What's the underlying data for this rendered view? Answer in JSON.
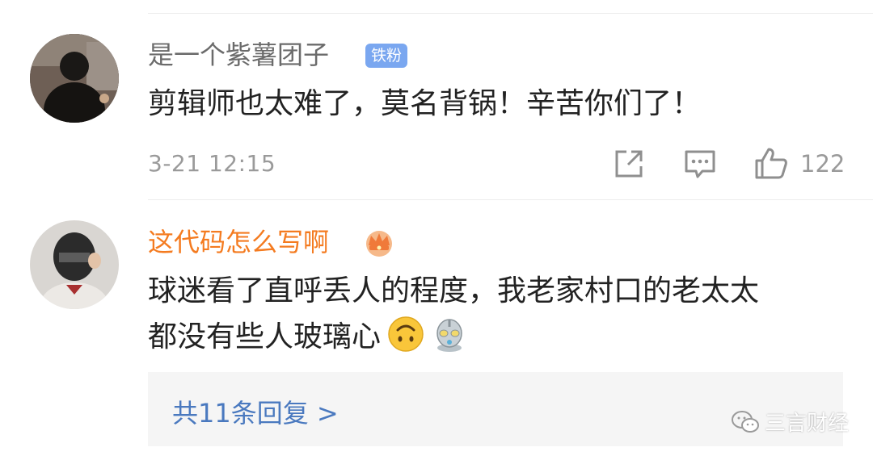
{
  "comments": [
    {
      "username": "是一个紫薯团子",
      "badge": "铁粉",
      "text": "剪辑师也太难了，莫名背锅！辛苦你们了！",
      "timestamp": "3-21 12:15",
      "like_count": "122",
      "icons": [
        "avatar-photo",
        "share-icon",
        "reply-icon",
        "like-icon"
      ]
    },
    {
      "username": "这代码怎么写啊",
      "badge_icon": "crown-icon",
      "text_line1": "球迷看了直呼丢人的程度，我老家村口的老太太",
      "text_line2": "都没有些人玻璃心",
      "emojis": [
        "upside-down-face-emoji",
        "robot-emoji"
      ],
      "reply_link": "共11条回复 >"
    }
  ],
  "watermark": {
    "label": "三言财经",
    "icon": "wechat-icon"
  },
  "colors": {
    "vip_name": "#f47b20",
    "link": "#4a79bf",
    "badge_bg": "#7aa7f0",
    "muted": "#9a9a9a"
  }
}
